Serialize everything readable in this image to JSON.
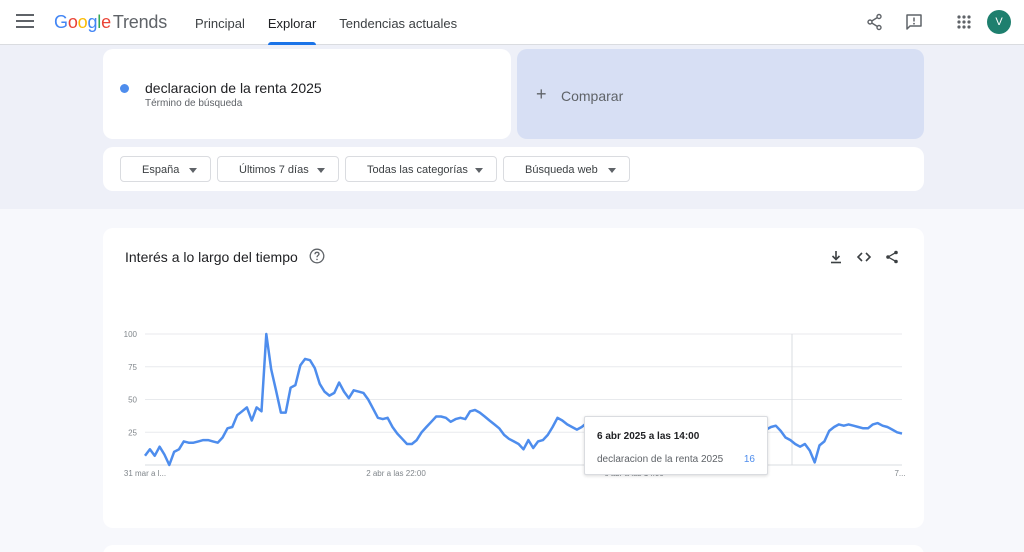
{
  "header": {
    "logo_google": [
      "G",
      "o",
      "o",
      "g",
      "l",
      "e"
    ],
    "logo_trends": "Trends",
    "nav": [
      {
        "label": "Principal",
        "active": false
      },
      {
        "label": "Explorar",
        "active": true
      },
      {
        "label": "Tendencias actuales",
        "active": false
      }
    ],
    "avatar_letter": "V",
    "icons": [
      "menu-icon",
      "share-icon",
      "feedback-icon",
      "apps-icon"
    ]
  },
  "search": {
    "term": "declaracion de la renta 2025",
    "term_type": "Término de búsqueda",
    "term_color": "#4e8ded",
    "compare_label": "Comparar"
  },
  "filters": [
    {
      "label": "España"
    },
    {
      "label": "Últimos 7 días"
    },
    {
      "label": "Todas las categorías"
    },
    {
      "label": "Búsqueda web"
    }
  ],
  "chart_card": {
    "title": "Interés a lo largo del tiempo",
    "icons": [
      "help-icon",
      "download-icon",
      "embed-icon",
      "share-icon"
    ]
  },
  "chart_data": {
    "type": "line",
    "title": "Interés a lo largo del tiempo",
    "ylim": [
      0,
      100
    ],
    "yticks": [
      25,
      50,
      75,
      100
    ],
    "xtick_labels": [
      "31 mar a l...",
      "2 abr a las 22:00",
      "6 abr a las 14:00",
      "7..."
    ],
    "series": [
      {
        "name": "declaracion de la renta 2025",
        "color": "#4e8ded",
        "values": [
          7,
          12,
          7,
          14,
          8,
          0,
          10,
          12,
          18,
          17,
          17,
          18,
          19,
          19,
          18,
          17,
          21,
          28,
          29,
          38,
          41,
          44,
          34,
          44,
          41,
          100,
          73,
          57,
          40,
          40,
          59,
          61,
          76,
          81,
          80,
          74,
          62,
          56,
          53,
          55,
          63,
          56,
          51,
          57,
          56,
          55,
          50,
          43,
          36,
          35,
          36,
          29,
          24,
          20,
          16,
          16,
          19,
          25,
          29,
          33,
          37,
          37,
          36,
          33,
          35,
          36,
          35,
          41,
          42,
          40,
          37,
          34,
          31,
          28,
          23,
          20,
          18,
          16,
          12,
          19,
          13,
          18,
          19,
          23,
          29,
          36,
          34,
          31,
          29,
          27,
          29,
          32,
          34,
          33,
          30,
          26,
          23,
          21,
          20,
          19,
          16,
          15,
          14,
          17,
          13,
          12,
          14,
          16,
          22,
          24,
          22,
          20,
          18,
          16,
          14,
          13,
          15,
          19,
          20,
          22,
          24,
          27,
          30,
          28,
          24,
          22,
          23,
          24,
          27,
          29,
          30,
          26,
          21,
          19,
          16,
          14,
          16,
          11,
          2,
          15,
          18,
          26,
          29,
          31,
          30,
          31,
          30,
          29,
          28,
          28,
          31,
          32,
          30,
          29,
          27,
          25,
          24
        ]
      }
    ],
    "tooltip": {
      "date": "6 abr 2025 a las 14:00",
      "term": "declaracion de la renta 2025",
      "value": "16"
    }
  }
}
